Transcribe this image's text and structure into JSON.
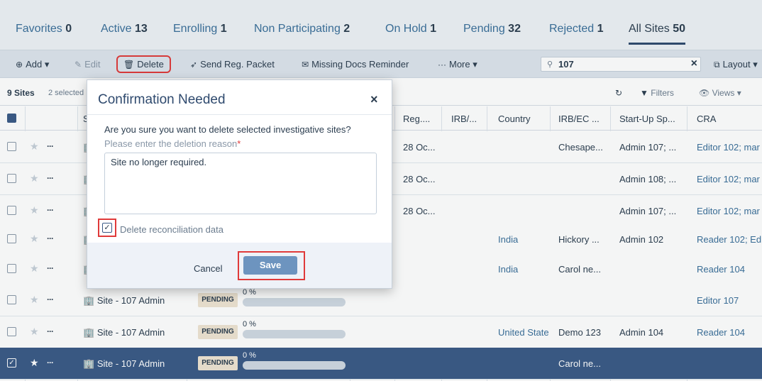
{
  "tabs": [
    {
      "label": "Favorites",
      "count": "0"
    },
    {
      "label": "Active",
      "count": "13"
    },
    {
      "label": "Enrolling",
      "count": "1"
    },
    {
      "label": "Non Participating",
      "count": "2"
    },
    {
      "label": "On Hold",
      "count": "1"
    },
    {
      "label": "Pending",
      "count": "32"
    },
    {
      "label": "Rejected",
      "count": "1"
    },
    {
      "label": "All Sites",
      "count": "50"
    }
  ],
  "toolbar": {
    "add": "Add",
    "edit": "Edit",
    "delete": "Delete",
    "send_reg_packet": "Send Reg. Packet",
    "missing_docs": "Missing Docs Reminder",
    "more": "More",
    "layout": "Layout"
  },
  "search": {
    "value": "107"
  },
  "subbar": {
    "count": "9 Sites",
    "selected": "2 selected",
    "filters": "Filters",
    "views": "Views"
  },
  "columns": [
    "Site",
    "Reg....",
    "IRB/...",
    "Country",
    "IRB/EC ...",
    "Start-Up Sp...",
    "CRA"
  ],
  "rows": [
    {
      "site": "",
      "status": "",
      "progress": "",
      "reg": "28 Oc...",
      "irb": "",
      "country": "",
      "irbec": "Chesape...",
      "startup": "Admin 107; ...",
      "cra": "Editor 102; mar",
      "selected": false
    },
    {
      "site": "",
      "status": "",
      "progress": "",
      "reg": "28 Oc...",
      "irb": "",
      "country": "",
      "irbec": "",
      "startup": "Admin 108; ...",
      "cra": "Editor 102; mar",
      "selected": false
    },
    {
      "site": "",
      "status": "",
      "progress": "",
      "reg": "28 Oc...",
      "irb": "",
      "country": "",
      "irbec": "",
      "startup": "Admin 107; ...",
      "cra": "Editor 102; mar",
      "selected": false
    },
    {
      "site": "",
      "status": "",
      "progress": "",
      "reg": "",
      "irb": "",
      "country": "India",
      "irbec": "Hickory ...",
      "startup": "Admin 102",
      "cra": "Reader 102; Ed",
      "selected": false
    },
    {
      "site": "",
      "status": "",
      "progress": "",
      "reg": "",
      "irb": "",
      "country": "India",
      "irbec": "Carol ne...",
      "startup": "",
      "cra": "Reader 104",
      "selected": false
    },
    {
      "site": "Site - 107 Admin",
      "status": "PENDING",
      "progress": "0 %",
      "reg": "",
      "irb": "",
      "country": "",
      "irbec": "",
      "startup": "",
      "cra": "Editor 107",
      "selected": false
    },
    {
      "site": "Site - 107 Admin",
      "status": "PENDING",
      "progress": "0 %",
      "reg": "",
      "irb": "",
      "country": "United State",
      "irbec": "Demo 123",
      "startup": "Admin 104",
      "cra": "Reader 104",
      "selected": false
    },
    {
      "site": "Site - 107 Admin",
      "status": "PENDING",
      "progress": "0 %",
      "reg": "",
      "irb": "",
      "country": "",
      "irbec": "Carol ne...",
      "startup": "",
      "cra": "",
      "selected": true
    }
  ],
  "modal": {
    "title": "Confirmation Needed",
    "close": "×",
    "question": "Are you sure you want to delete selected investigative sites?",
    "reason_label": "Please enter the deletion reason",
    "required_mark": "*",
    "reason_value": "Site no longer required.",
    "checkbox_label": "Delete reconciliation data",
    "checkbox_checked": true,
    "cancel": "Cancel",
    "save": "Save"
  },
  "colors": {
    "accent": "#3a5a86",
    "highlight": "#e03a3a",
    "save": "#6d94bf"
  }
}
